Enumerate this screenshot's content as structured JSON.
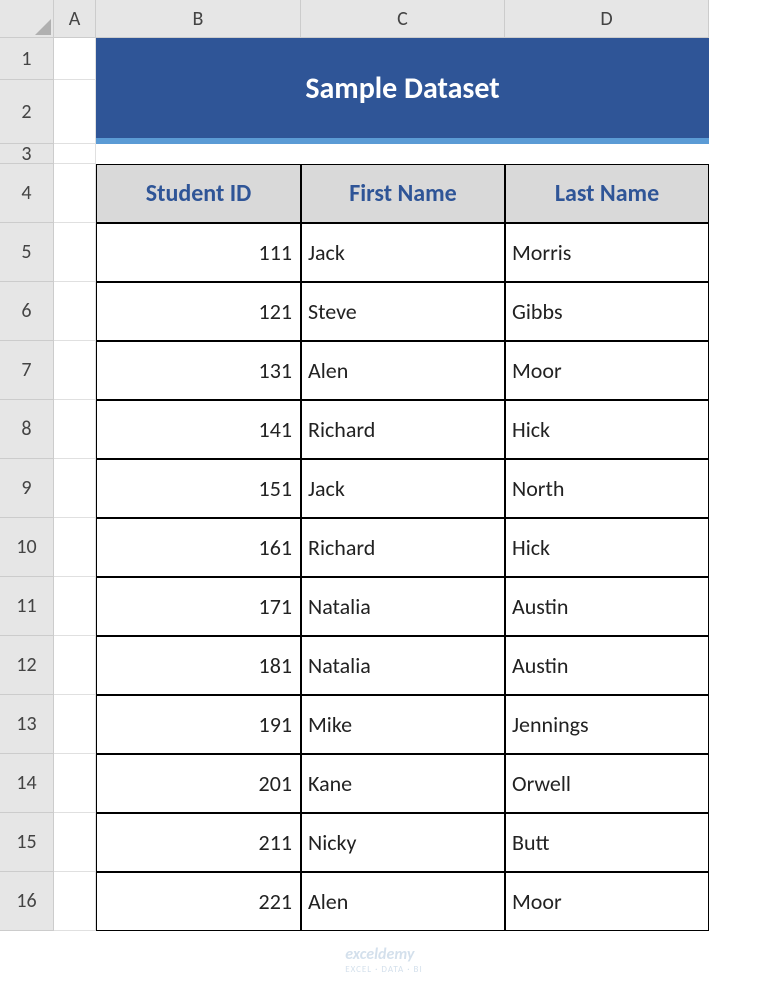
{
  "columns": [
    "A",
    "B",
    "C",
    "D"
  ],
  "rows": [
    "1",
    "2",
    "3",
    "4",
    "5",
    "6",
    "7",
    "8",
    "9",
    "10",
    "11",
    "12",
    "13",
    "14",
    "15",
    "16"
  ],
  "title": "Sample Dataset",
  "headers": {
    "b": "Student ID",
    "c": "First Name",
    "d": "Last Name"
  },
  "data": [
    {
      "id": "111",
      "first": "Jack",
      "last": "Morris"
    },
    {
      "id": "121",
      "first": "Steve",
      "last": "Gibbs"
    },
    {
      "id": "131",
      "first": "Alen",
      "last": "Moor"
    },
    {
      "id": "141",
      "first": "Richard",
      "last": "Hick"
    },
    {
      "id": "151",
      "first": "Jack",
      "last": "North"
    },
    {
      "id": "161",
      "first": "Richard",
      "last": "Hick"
    },
    {
      "id": "171",
      "first": "Natalia",
      "last": "Austin"
    },
    {
      "id": "181",
      "first": "Natalia",
      "last": "Austin"
    },
    {
      "id": "191",
      "first": "Mike",
      "last": "Jennings"
    },
    {
      "id": "201",
      "first": "Kane",
      "last": "Orwell"
    },
    {
      "id": "211",
      "first": "Nicky",
      "last": "Butt"
    },
    {
      "id": "221",
      "first": "Alen",
      "last": "Moor"
    }
  ],
  "watermark": {
    "main": "exceldemy",
    "sub": "EXCEL · DATA · BI"
  }
}
